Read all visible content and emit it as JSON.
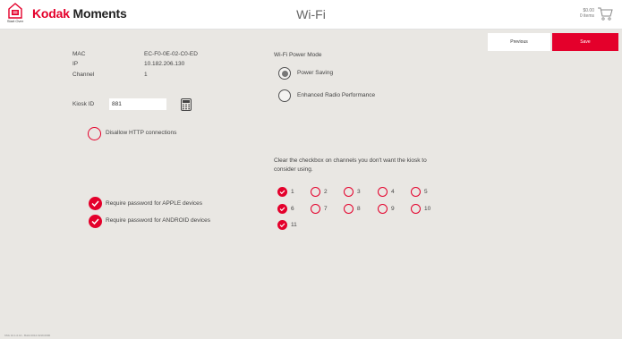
{
  "header": {
    "home_label": "Start Over",
    "brand_kodak": "Kodak",
    "brand_moments": "Moments",
    "title": "Wi-Fi",
    "cart_amount": "$0.00",
    "cart_items": "0 items"
  },
  "actions": {
    "previous_label": "Previous",
    "save_label": "Save"
  },
  "network_info": {
    "mac_label": "MAC",
    "mac_value": "EC-F0-0E-02-C0-ED",
    "ip_label": "IP",
    "ip_value": "10.182.206.130",
    "channel_label": "Channel",
    "channel_value": "1"
  },
  "kiosk": {
    "label": "Kiosk ID",
    "value": "881"
  },
  "http": {
    "label": "Disallow HTTP connections",
    "checked": false
  },
  "passwords": {
    "apple_label": "Require password for APPLE devices",
    "apple_checked": true,
    "android_label": "Require password for ANDROID devices",
    "android_checked": true
  },
  "power_mode": {
    "title": "Wi-Fi Power Mode",
    "options": [
      {
        "label": "Power Saving",
        "selected": true
      },
      {
        "label": "Enhanced Radio Performance",
        "selected": false
      }
    ]
  },
  "channels": {
    "instructions_line1": "Clear the checkbox on channels you don't want the kiosk to",
    "instructions_line2": "consider using.",
    "items": [
      {
        "label": "1",
        "checked": true
      },
      {
        "label": "2",
        "checked": false
      },
      {
        "label": "3",
        "checked": false
      },
      {
        "label": "4",
        "checked": false
      },
      {
        "label": "5",
        "checked": false
      },
      {
        "label": "6",
        "checked": true
      },
      {
        "label": "7",
        "checked": false
      },
      {
        "label": "8",
        "checked": false
      },
      {
        "label": "9",
        "checked": false
      },
      {
        "label": "10",
        "checked": false
      },
      {
        "label": "11",
        "checked": true
      }
    ]
  },
  "footer": {
    "version": "KMx 10.1.0.10 - Build 2012.0219.0000"
  },
  "colors": {
    "accent": "#e4002b",
    "background": "#e9e7e3"
  }
}
